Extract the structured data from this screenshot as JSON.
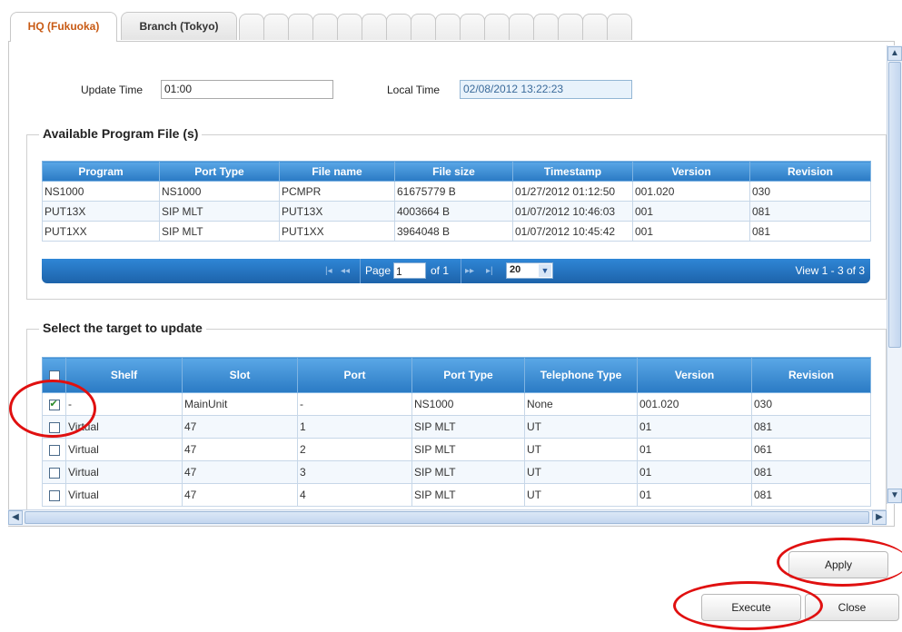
{
  "tabs": [
    {
      "label": "HQ (Fukuoka)"
    },
    {
      "label": "Branch (Tokyo)"
    }
  ],
  "top": {
    "update_time_label": "Update Time",
    "update_time_value": "01:00",
    "local_time_label": "Local Time",
    "local_time_value": "02/08/2012 13:22:23"
  },
  "program_files": {
    "legend": "Available Program File (s)",
    "columns": [
      "Program",
      "Port Type",
      "File name",
      "File size",
      "Timestamp",
      "Version",
      "Revision"
    ],
    "rows": [
      [
        "NS1000",
        "NS1000",
        "PCMPR",
        "61675779 B",
        "01/27/2012 01:12:50",
        "001.020",
        "030"
      ],
      [
        "PUT13X",
        "SIP MLT",
        "PUT13X",
        "4003664 B",
        "01/07/2012 10:46:03",
        "001",
        "081"
      ],
      [
        "PUT1XX",
        "SIP MLT",
        "PUT1XX",
        "3964048 B",
        "01/07/2012 10:45:42",
        "001",
        "081"
      ]
    ],
    "pager": {
      "page_label": "Page",
      "page_value": "1",
      "of_label": "of 1",
      "page_size": "20",
      "view_text": "View 1 - 3 of 3"
    }
  },
  "targets": {
    "legend": "Select the target to update",
    "columns": [
      "Shelf",
      "Slot",
      "Port",
      "Port Type",
      "Telephone Type",
      "Version",
      "Revision"
    ],
    "rows": [
      {
        "checked": true,
        "cells": [
          "-",
          "MainUnit",
          "-",
          "NS1000",
          "None",
          "001.020",
          "030"
        ]
      },
      {
        "checked": false,
        "cells": [
          "Virtual",
          "47",
          "1",
          "SIP MLT",
          "UT",
          "01",
          "081"
        ]
      },
      {
        "checked": false,
        "cells": [
          "Virtual",
          "47",
          "2",
          "SIP MLT",
          "UT",
          "01",
          "061"
        ]
      },
      {
        "checked": false,
        "cells": [
          "Virtual",
          "47",
          "3",
          "SIP MLT",
          "UT",
          "01",
          "081"
        ]
      },
      {
        "checked": false,
        "cells": [
          "Virtual",
          "47",
          "4",
          "SIP MLT",
          "UT",
          "01",
          "081"
        ]
      }
    ]
  },
  "buttons": {
    "apply": "Apply",
    "execute": "Execute",
    "close": "Close"
  },
  "colors": {
    "active_tab": "#c85a14",
    "grid_header": "#2a7ac4",
    "highlight_ring": "#e01010"
  }
}
